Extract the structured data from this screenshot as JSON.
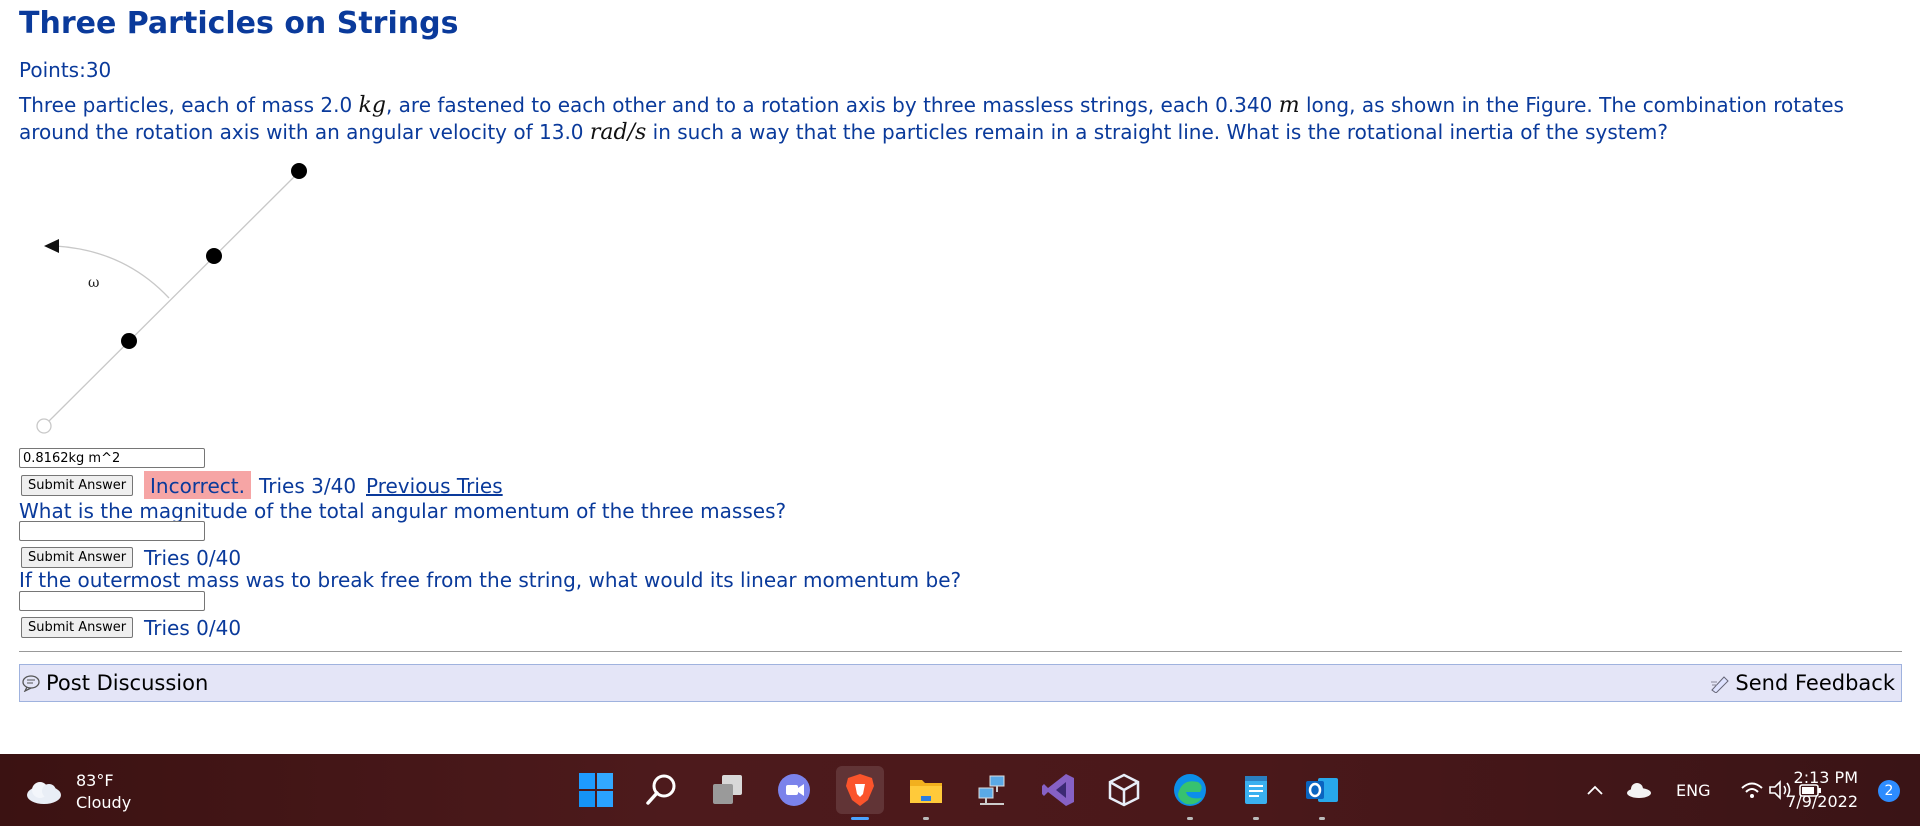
{
  "page": {
    "title": "Three Particles on Strings",
    "points": "Points:30"
  },
  "question": {
    "t1": "Three particles, each of mass 2.0 ",
    "m1": "kg",
    "t2": ", are fastened to each other and to a rotation axis by three massless strings, each 0.340 ",
    "m2": "m",
    "t3": " long, as shown in the Figure. The combination rotates around the rotation axis with an angular velocity of 13.0 ",
    "m3": "rad/s",
    "t4": " in such a way that the particles remain in a straight line. What is the rotational inertia of the system?"
  },
  "figure": {
    "omega_label": "ω"
  },
  "parts": [
    {
      "answer_value": "0.8162kg m^2",
      "submit_label": "Submit Answer",
      "status": "Incorrect.",
      "tries": "Tries 3/40",
      "previous_tries": "Previous Tries"
    },
    {
      "question": "What is the magnitude of the total angular momentum of the three masses?",
      "answer_value": "",
      "submit_label": "Submit Answer",
      "tries": "Tries 0/40"
    },
    {
      "question": "If the outermost mass was to break free from the string, what would its linear momentum be?",
      "answer_value": "",
      "submit_label": "Submit Answer",
      "tries": "Tries 0/40"
    }
  ],
  "footer_bar": {
    "post_discussion": "Post Discussion",
    "send_feedback": "Send Feedback"
  },
  "taskbar": {
    "weather_temp": "83°F",
    "weather_desc": "Cloudy",
    "apps": [
      "windows-start-icon",
      "search-icon",
      "task-view-icon",
      "teams-chat-icon",
      "brave-browser-icon",
      "file-explorer-icon",
      "network-app-icon",
      "visual-studio-icon",
      "virtualbox-icon",
      "edge-browser-icon",
      "notepad-icon",
      "outlook-icon"
    ],
    "language": "ENG",
    "time": "2:13 PM",
    "date": "7/9/2022",
    "notification_count": "2"
  }
}
